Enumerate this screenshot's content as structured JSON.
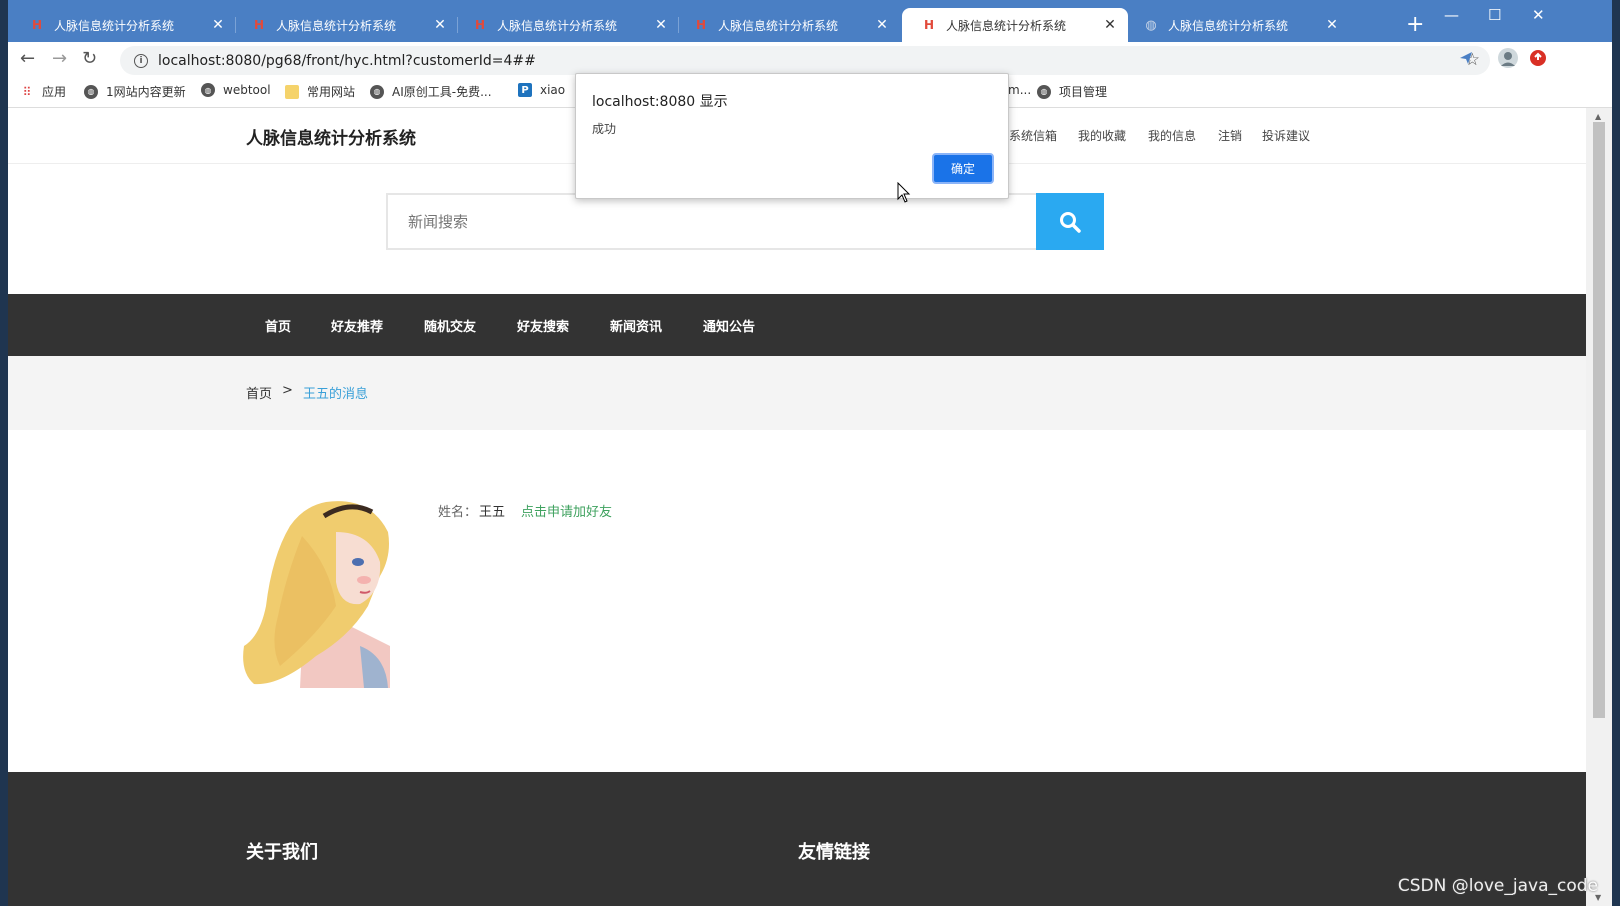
{
  "browser": {
    "tabs": [
      {
        "title": "人脉信息统计分析系统",
        "active": false,
        "favicon": "h-icon"
      },
      {
        "title": "人脉信息统计分析系统",
        "active": false,
        "favicon": "h-icon"
      },
      {
        "title": "人脉信息统计分析系统",
        "active": false,
        "favicon": "h-icon"
      },
      {
        "title": "人脉信息统计分析系统",
        "active": false,
        "favicon": "h-icon"
      },
      {
        "title": "人脉信息统计分析系统",
        "active": true,
        "favicon": "h-icon"
      },
      {
        "title": "人脉信息统计分析系统",
        "active": false,
        "favicon": "globe-icon"
      }
    ],
    "url": "localhost:8080/pg68/front/hyc.html?customerId=4##",
    "bookmarks": [
      {
        "label": "应用",
        "icon": "apps-icon"
      },
      {
        "label": "1网站内容更新",
        "icon": "globe-icon"
      },
      {
        "label": "webtool",
        "icon": "globe-icon"
      },
      {
        "label": "常用网站",
        "icon": "folder-icon"
      },
      {
        "label": "AI原创工具-免费...",
        "icon": "globe-icon"
      },
      {
        "label": "xiao",
        "icon": "p-icon"
      },
      {
        "label": "m...",
        "icon": "none"
      },
      {
        "label": "项目管理",
        "icon": "globe-icon"
      }
    ]
  },
  "site": {
    "title": "人脉信息统计分析系统",
    "top_links": [
      "系统信箱",
      "我的收藏",
      "我的信息",
      "注销",
      "投诉建议"
    ],
    "search_placeholder": "新闻搜索",
    "nav": [
      "首页",
      "好友推荐",
      "随机交友",
      "好友搜索",
      "新闻资讯",
      "通知公告"
    ],
    "breadcrumb": {
      "home": "首页",
      "separator": ">",
      "current": "王五的消息"
    },
    "profile": {
      "name_label": "姓名：",
      "name": "王五",
      "add_friend": "点击申请加好友"
    },
    "footer": {
      "about": "关于我们",
      "links": "友情链接"
    }
  },
  "dialog": {
    "title": "localhost:8080 显示",
    "message": "成功",
    "ok_label": "确定"
  },
  "watermark": "CSDN @love_java_code",
  "colors": {
    "tabstrip": "#4a7fc4",
    "nav_bg": "#333333",
    "search_button": "#2aa9f1",
    "breadcrumb_active": "#3aa0d8",
    "add_friend": "#3fa25f",
    "dialog_button": "#1a73e8"
  }
}
